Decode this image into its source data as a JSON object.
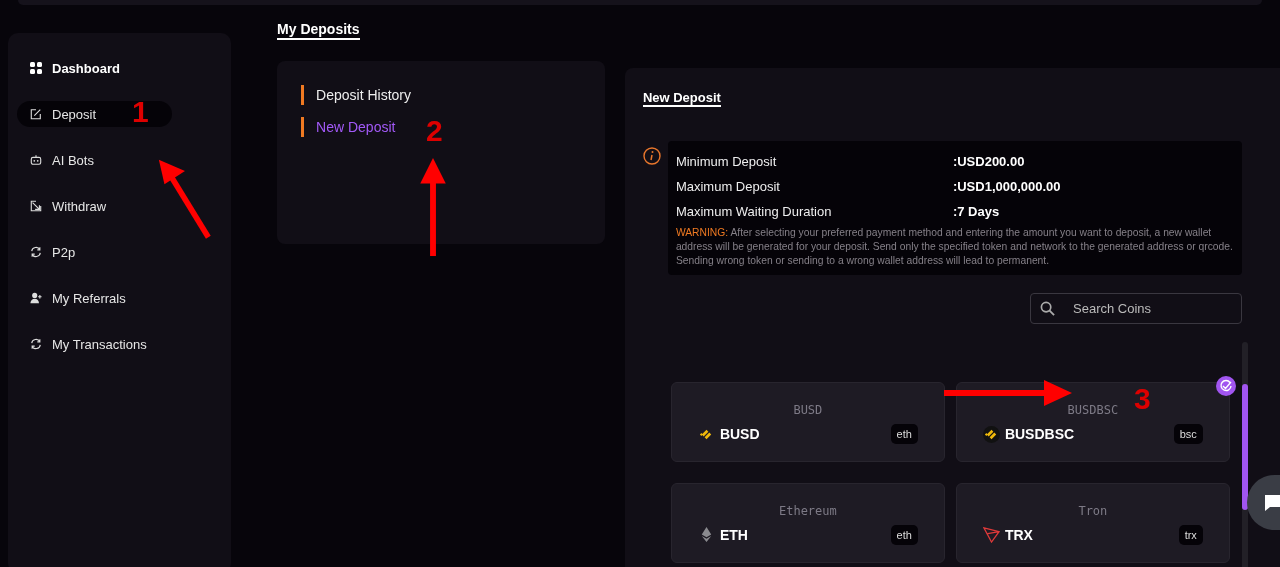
{
  "sidebar": {
    "items": [
      {
        "label": "Dashboard",
        "kind": "heading",
        "selected": false
      },
      {
        "label": "Deposit",
        "kind": "link",
        "selected": true
      },
      {
        "label": "AI Bots",
        "kind": "link",
        "selected": false
      },
      {
        "label": "Withdraw",
        "kind": "link",
        "selected": false
      },
      {
        "label": "P2p",
        "kind": "link",
        "selected": false
      },
      {
        "label": "My Referrals",
        "kind": "link",
        "selected": false
      },
      {
        "label": "My Transactions",
        "kind": "link",
        "selected": false
      }
    ]
  },
  "page_title": "My Deposits",
  "deposit_menu": [
    {
      "label": "Deposit History",
      "selected": false
    },
    {
      "label": "New Deposit",
      "selected": true
    }
  ],
  "new_deposit": {
    "title": "New Deposit",
    "info": [
      {
        "label": "Minimum Deposit",
        "value": ":USD200.00"
      },
      {
        "label": "Maximum Deposit",
        "value": ":USD1,000,000.00"
      },
      {
        "label": "Maximum Waiting Duration",
        "value": ":7 Days"
      }
    ],
    "warning_label": "WARNING:",
    "warning": "After selecting your preferred payment method and entering the amount you want to deposit, a new wallet address will be generated for your deposit. Send only the specified token and network to the generated address or qrcode. Sending wrong token or sending to a wrong wallet address will lead to permanent.",
    "search": {
      "placeholder": "Search Coins"
    },
    "coins": [
      {
        "name": "BUSD",
        "symbol": "BUSD",
        "network": "eth",
        "selected": false
      },
      {
        "name": "BUSDBSC",
        "symbol": "BUSDBSC",
        "network": "bsc",
        "selected": true
      },
      {
        "name": "Ethereum",
        "symbol": "ETH",
        "network": "eth",
        "selected": false
      },
      {
        "name": "Tron",
        "symbol": "TRX",
        "network": "trx",
        "selected": false
      }
    ]
  },
  "annotations": [
    "1",
    "2",
    "3"
  ]
}
